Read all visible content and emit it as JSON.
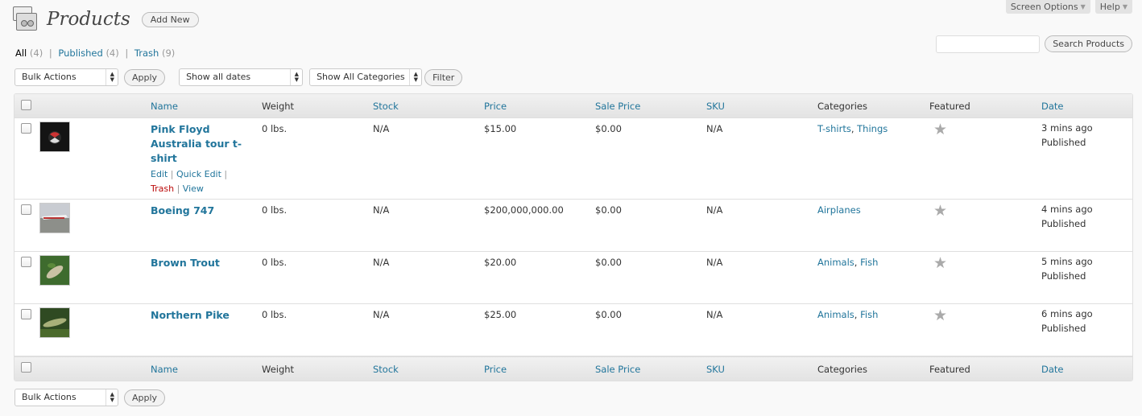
{
  "screen_tabs": {
    "screen_options": "Screen Options",
    "help": "Help"
  },
  "header": {
    "title": "Products",
    "add_new": "Add New"
  },
  "views": {
    "all": {
      "label": "All",
      "count": "(4)"
    },
    "published": {
      "label": "Published",
      "count": "(4)"
    },
    "trash": {
      "label": "Trash",
      "count": "(9)"
    },
    "separator": "|"
  },
  "search": {
    "button": "Search Products",
    "value": ""
  },
  "tablenav_top": {
    "bulk_actions": "Bulk Actions",
    "apply": "Apply",
    "dates": "Show all dates",
    "categories": "Show All Categories",
    "filter": "Filter"
  },
  "tablenav_bottom": {
    "bulk_actions": "Bulk Actions",
    "apply": "Apply"
  },
  "columns": {
    "name": "Name",
    "weight": "Weight",
    "stock": "Stock",
    "price": "Price",
    "sale_price": "Sale Price",
    "sku": "SKU",
    "categories": "Categories",
    "featured": "Featured",
    "date": "Date"
  },
  "row_actions": {
    "edit": "Edit",
    "quick_edit": "Quick Edit",
    "trash": "Trash",
    "view": "View"
  },
  "products": [
    {
      "name": "Pink Floyd Australia tour t-shirt",
      "weight": "0 lbs.",
      "stock": "N/A",
      "price": "$15.00",
      "sale_price": "$0.00",
      "sku": "N/A",
      "categories": [
        "T-shirts",
        "Things"
      ],
      "featured_icon": "star-icon",
      "date": "3 mins ago",
      "status": "Published"
    },
    {
      "name": "Boeing 747",
      "weight": "0 lbs.",
      "stock": "N/A",
      "price": "$200,000,000.00",
      "sale_price": "$0.00",
      "sku": "N/A",
      "categories": [
        "Airplanes"
      ],
      "featured_icon": "star-icon",
      "date": "4 mins ago",
      "status": "Published"
    },
    {
      "name": "Brown Trout",
      "weight": "0 lbs.",
      "stock": "N/A",
      "price": "$20.00",
      "sale_price": "$0.00",
      "sku": "N/A",
      "categories": [
        "Animals",
        "Fish"
      ],
      "featured_icon": "star-icon",
      "date": "5 mins ago",
      "status": "Published"
    },
    {
      "name": "Northern Pike",
      "weight": "0 lbs.",
      "stock": "N/A",
      "price": "$25.00",
      "sale_price": "$0.00",
      "sku": "N/A",
      "categories": [
        "Animals",
        "Fish"
      ],
      "featured_icon": "star-icon",
      "date": "6 mins ago",
      "status": "Published"
    }
  ],
  "colors": {
    "link": "#21759b",
    "trash": "#bc0b0b",
    "star": "#aaaaaa"
  }
}
